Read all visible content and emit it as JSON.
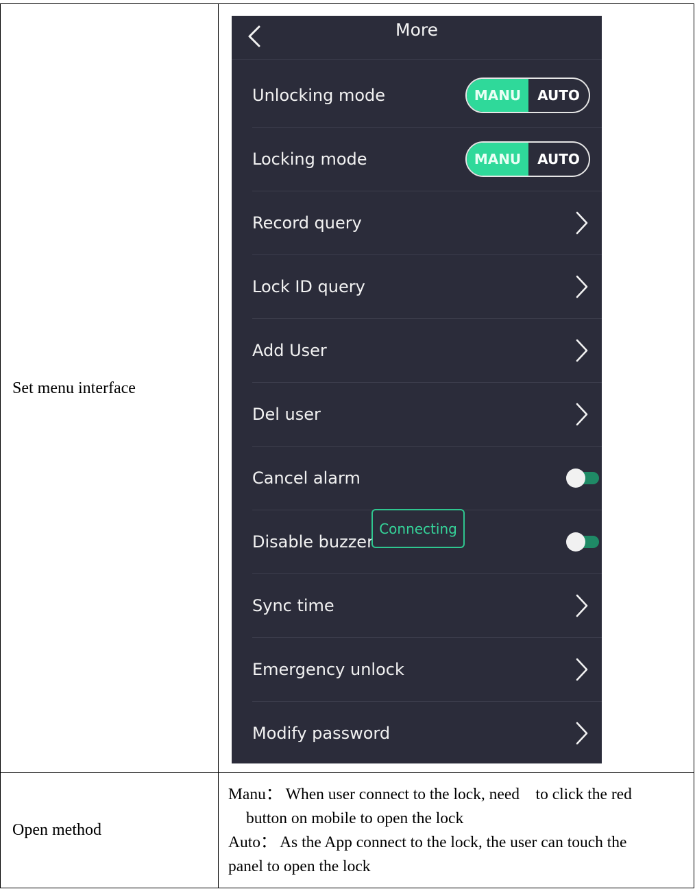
{
  "table": {
    "row1_label": "Set menu interface",
    "row2_label": "Open method",
    "row2_desc": {
      "manu_line1": "Manu： When user connect to the lock, need　to click the red",
      "manu_line2": "button on mobile to open the lock",
      "auto_line1": "Auto： As the App connect to the lock, the user can touch the",
      "auto_line2": "panel to open the lock"
    }
  },
  "screen": {
    "title": "More",
    "items": [
      {
        "label": "Unlocking mode",
        "control": "segmented",
        "options": [
          "MANU",
          "AUTO"
        ],
        "selected": "MANU"
      },
      {
        "label": "Locking mode",
        "control": "segmented",
        "options": [
          "MANU",
          "AUTO"
        ],
        "selected": "MANU"
      },
      {
        "label": "Record query",
        "control": "chevron"
      },
      {
        "label": "Lock ID query",
        "control": "chevron"
      },
      {
        "label": "Add User",
        "control": "chevron"
      },
      {
        "label": "Del user",
        "control": "chevron"
      },
      {
        "label": "Cancel alarm",
        "control": "toggle",
        "state": "off"
      },
      {
        "label": "Disable buzzer",
        "control": "toggle",
        "state": "off"
      },
      {
        "label": "Sync time",
        "control": "chevron"
      },
      {
        "label": "Emergency unlock",
        "control": "chevron"
      },
      {
        "label": "Modify password",
        "control": "chevron"
      }
    ],
    "toast": "Connecting",
    "colors": {
      "background": "#2b2c3a",
      "accent": "#2fd99a",
      "divider": "#3d3e4d"
    }
  }
}
